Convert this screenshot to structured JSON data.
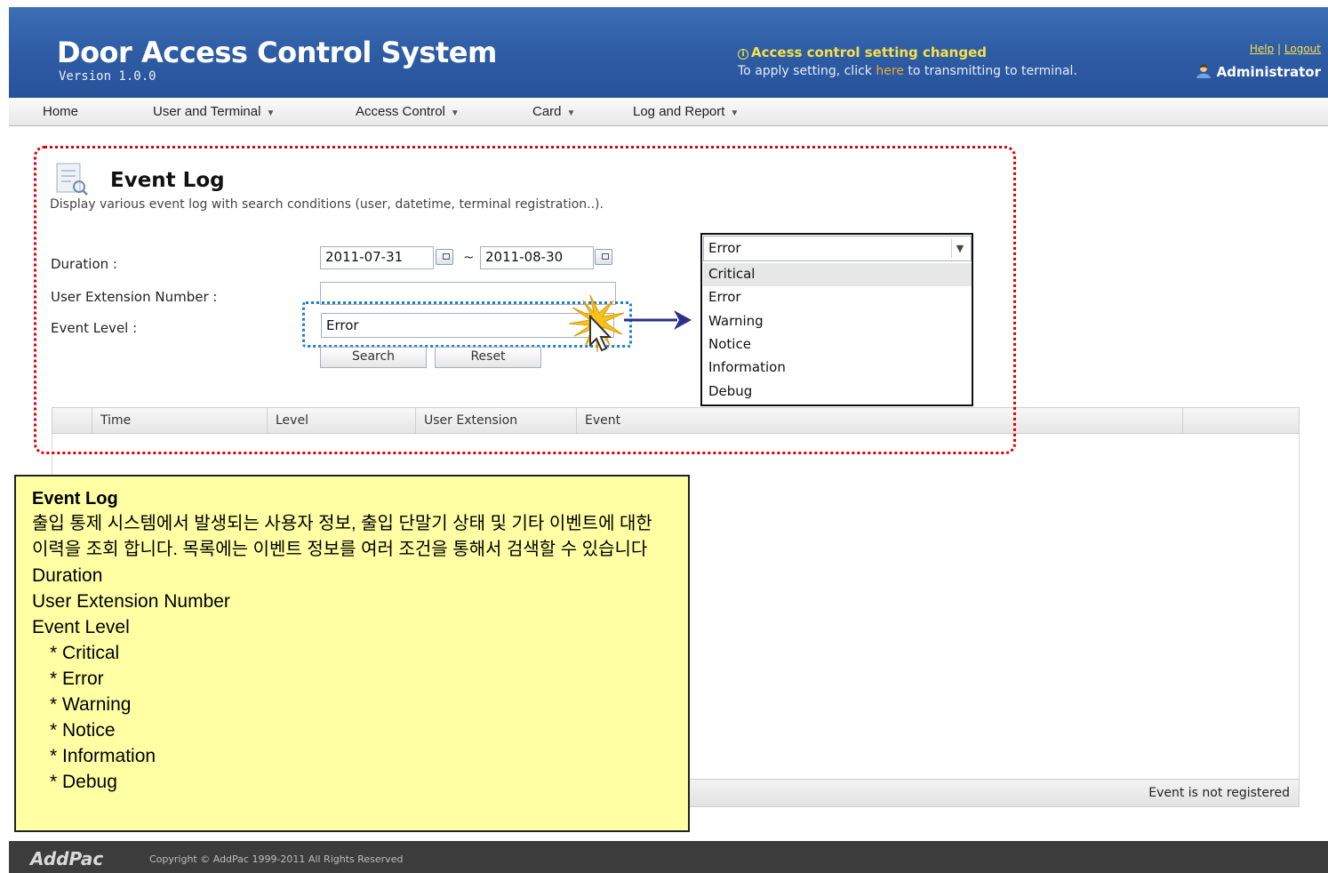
{
  "header": {
    "title": "Door Access Control System",
    "version": "Version 1.0.0",
    "notice_title": "Access control setting changed",
    "notice_text_before": "To apply setting, click ",
    "notice_link": "here",
    "notice_text_after": " to transmitting to terminal.",
    "help": "Help",
    "separator": "|",
    "logout": "Logout",
    "user": "Administrator"
  },
  "nav": {
    "home": "Home",
    "user_terminal": "User and Terminal",
    "access_control": "Access Control",
    "card": "Card",
    "log_report": "Log and Report"
  },
  "page": {
    "title": "Event Log",
    "description": "Display various event log with search conditions (user, datetime, terminal registration..)."
  },
  "form": {
    "duration_label": "Duration :",
    "date_from": "2011-07-31",
    "tilde": "~",
    "date_to": "2011-08-30",
    "extension_label": "User Extension Number :",
    "extension_value": "",
    "level_label": "Event Level :",
    "level_value": "Error",
    "search_button": "Search",
    "reset_button": "Reset"
  },
  "dropdown": {
    "selected": "Error",
    "options": [
      "Critical",
      "Error",
      "Warning",
      "Notice",
      "Information",
      "Debug"
    ]
  },
  "table": {
    "columns": [
      "Time",
      "Level",
      "User Extension",
      "Event"
    ],
    "status": "Event is not registered"
  },
  "footer": {
    "logo": "AddPac",
    "copyright": "Copyright © AddPac 1999-2011 All Rights Reserved"
  },
  "note": {
    "title": "Event Log",
    "body": "출입 통제 시스템에서 발생되는 사용자 정보, 출입 단말기 상태 및 기타 이벤트에 대한 이력을 조회 합니다. 목록에는 이벤트 정보를 여러 조건을 통해서 검색할 수 있습니다",
    "lines": [
      "Duration",
      "User Extension Number",
      "Event Level"
    ],
    "bullets": [
      "* Critical",
      "* Error",
      "* Warning",
      "* Notice",
      "* Information",
      "* Debug"
    ]
  },
  "colors": {
    "header_blue": "#2f5ea6",
    "notice_yellow": "#f6e04a",
    "focus_red": "#e00000",
    "focus_blue": "#1a7fd0",
    "note_yellow": "#ffffa4"
  }
}
